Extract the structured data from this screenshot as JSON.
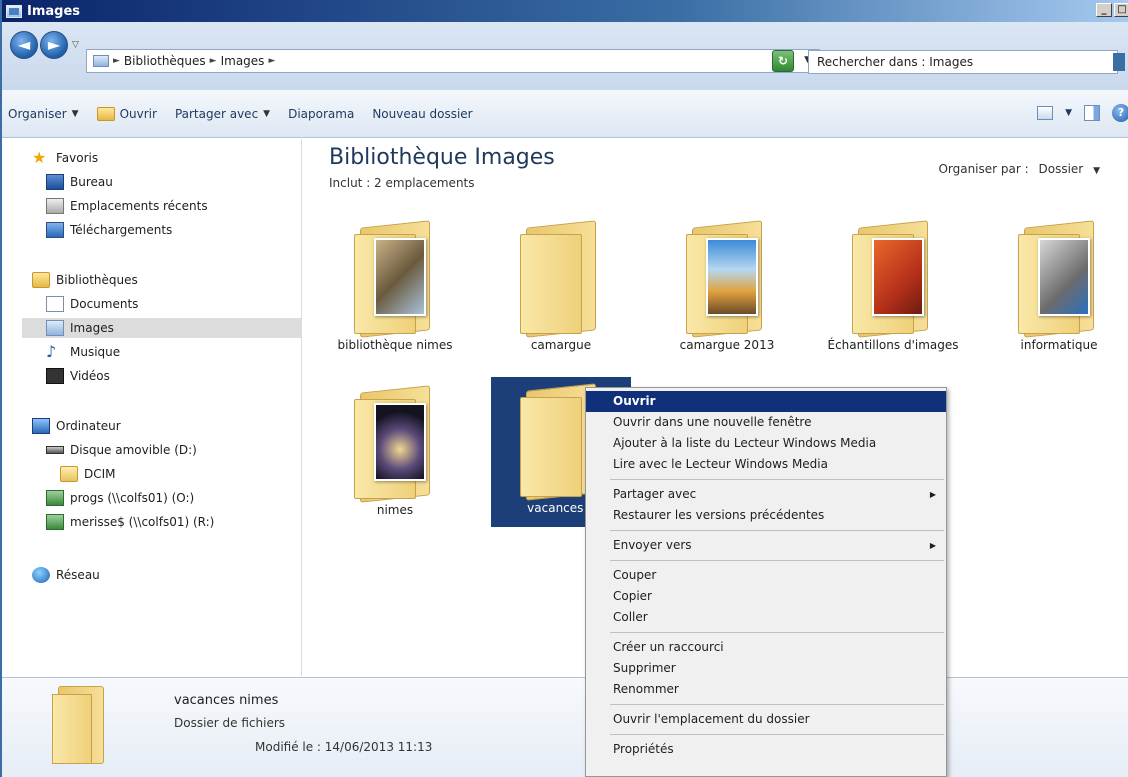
{
  "window": {
    "title": "Images",
    "controls": [
      "_",
      "□"
    ]
  },
  "address": {
    "breadcrumb": [
      "Bibliothèques",
      "Images"
    ],
    "search_placeholder": "Rechercher dans : Images"
  },
  "commandbar": {
    "organize": "Organiser",
    "open": "Ouvrir",
    "share": "Partager avec",
    "slideshow": "Diaporama",
    "new_folder": "Nouveau dossier"
  },
  "nav": {
    "favorites": "Favoris",
    "desktop": "Bureau",
    "recent": "Emplacements récents",
    "downloads": "Téléchargements",
    "libraries": "Bibliothèques",
    "documents": "Documents",
    "images": "Images",
    "music": "Musique",
    "videos": "Vidéos",
    "computer": "Ordinateur",
    "removable": "Disque amovible (D:)",
    "dcim": "DCIM",
    "progs": "progs (\\\\colfs01) (O:)",
    "merisse": "merisse$ (\\\\colfs01) (R:)",
    "network": "Réseau"
  },
  "main": {
    "title": "Bibliothèque Images",
    "subtitle": "Inclut : 2 emplacements",
    "arrange_label": "Organiser par :",
    "arrange_value": "Dossier",
    "folders": [
      {
        "name": "bibliothèque nimes"
      },
      {
        "name": "camargue"
      },
      {
        "name": "camargue 2013"
      },
      {
        "name": "Échantillons d'images"
      },
      {
        "name": "informatique"
      },
      {
        "name": "nimes"
      },
      {
        "name": "vacances n"
      }
    ]
  },
  "details": {
    "name": "vacances nimes",
    "type": "Dossier de fichiers",
    "modified": "Modifié le : 14/06/2013 11:13"
  },
  "context_menu": {
    "open": "Ouvrir",
    "open_new_window": "Ouvrir dans une nouvelle fenêtre",
    "add_wmp_list": "Ajouter à la liste du Lecteur Windows Media",
    "play_wmp": "Lire avec le Lecteur Windows Media",
    "share_with": "Partager avec",
    "restore_versions": "Restaurer les versions précédentes",
    "send_to": "Envoyer vers",
    "cut": "Couper",
    "copy": "Copier",
    "paste": "Coller",
    "create_shortcut": "Créer un raccourci",
    "delete": "Supprimer",
    "rename": "Renommer",
    "open_location": "Ouvrir l'emplacement du dossier",
    "properties": "Propriétés"
  }
}
